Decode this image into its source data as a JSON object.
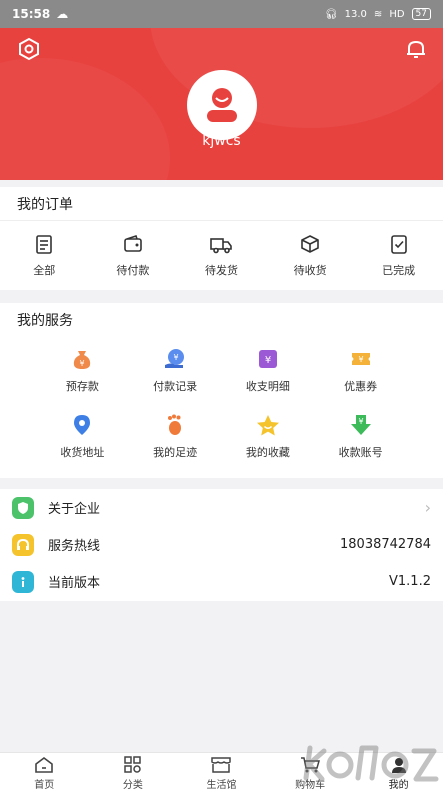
{
  "status_bar": {
    "time": "15:58",
    "network": "HD",
    "speed": "13.0",
    "battery": "57"
  },
  "header": {
    "username": "kjwcs"
  },
  "orders": {
    "title": "我的订单",
    "items": [
      {
        "label": "全部",
        "icon": "clipboard-icon"
      },
      {
        "label": "待付款",
        "icon": "wallet-icon"
      },
      {
        "label": "待发货",
        "icon": "truck-icon"
      },
      {
        "label": "待收货",
        "icon": "package-icon"
      },
      {
        "label": "已完成",
        "icon": "check-clipboard-icon"
      }
    ]
  },
  "services": {
    "title": "我的服务",
    "items": [
      {
        "label": "预存款",
        "icon": "money-bag-icon",
        "color": "#f08a4b"
      },
      {
        "label": "付款记录",
        "icon": "payment-record-icon",
        "color": "#5b8def"
      },
      {
        "label": "收支明细",
        "icon": "ledger-icon",
        "color": "#9b59d6"
      },
      {
        "label": "优惠券",
        "icon": "coupon-icon",
        "color": "#f5b23a"
      },
      {
        "label": "收货地址",
        "icon": "location-pin-icon",
        "color": "#3e7fe6"
      },
      {
        "label": "我的足迹",
        "icon": "footprint-icon",
        "color": "#f07a3a"
      },
      {
        "label": "我的收藏",
        "icon": "star-icon",
        "color": "#f5c32c"
      },
      {
        "label": "收款账号",
        "icon": "download-yen-icon",
        "color": "#3dbb5b"
      }
    ]
  },
  "info": {
    "about": {
      "label": "关于企业",
      "color": "#4cc26a"
    },
    "hotline": {
      "label": "服务热线",
      "value": "18038742784",
      "color": "#f5c32c"
    },
    "version": {
      "label": "当前版本",
      "value": "V1.1.2",
      "color": "#2fb6d6"
    }
  },
  "tabbar": {
    "tabs": [
      {
        "label": "首页",
        "icon": "home-icon"
      },
      {
        "label": "分类",
        "icon": "category-icon"
      },
      {
        "label": "生活馆",
        "icon": "shop-icon"
      },
      {
        "label": "购物车",
        "icon": "cart-icon"
      },
      {
        "label": "我的",
        "icon": "profile-icon"
      }
    ]
  },
  "colors": {
    "brand_red": "#e8423f",
    "background": "#f2f2f4"
  }
}
